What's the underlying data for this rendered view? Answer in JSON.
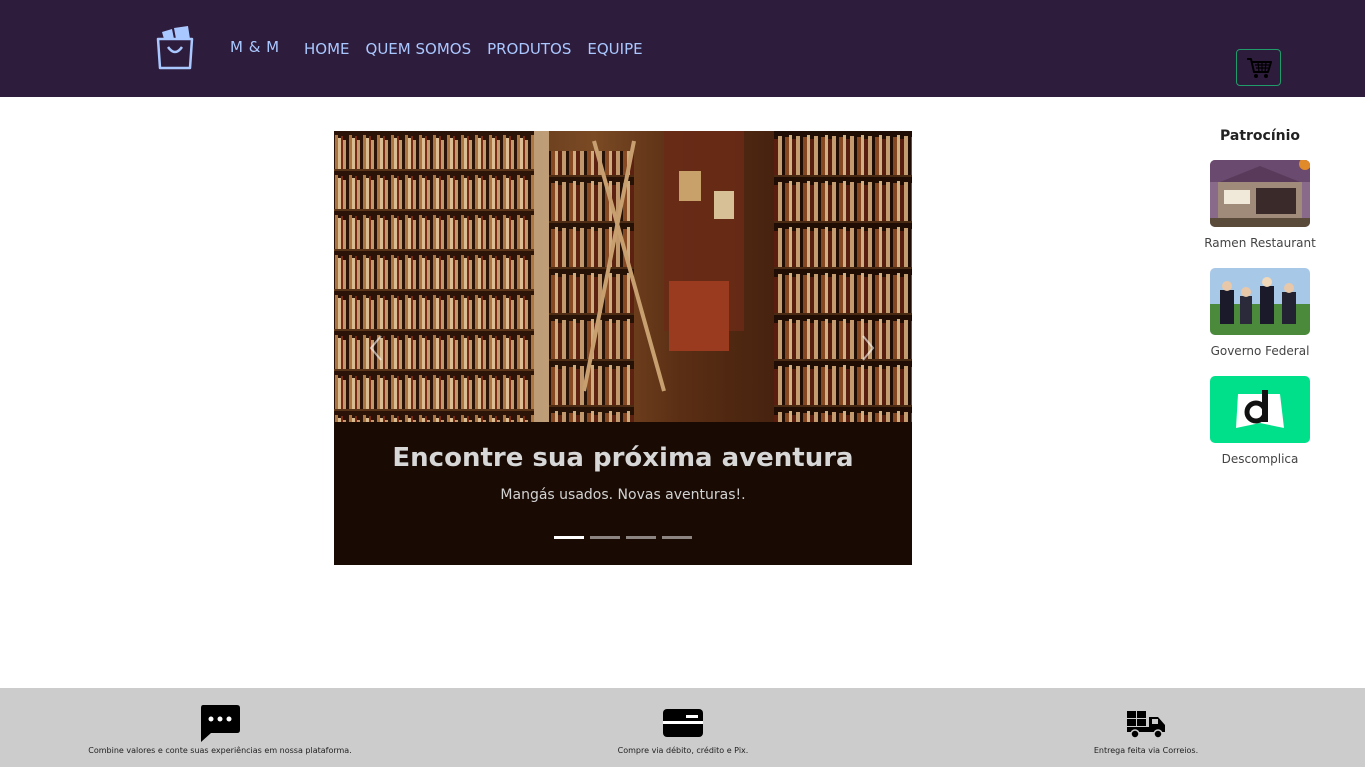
{
  "header": {
    "brand": "M & M",
    "nav": [
      "HOME",
      "QUEM SOMOS",
      "PRODUTOS",
      "EQUIPE"
    ],
    "logo_icon": "shopping-bag-icon",
    "cart_icon": "shopping-cart-icon"
  },
  "carousel": {
    "title": "Encontre sua próxima aventura",
    "subtitle": "Mangás usados. Novas aventuras!.",
    "slides_count": 4,
    "active_slide": 1
  },
  "sponsors": {
    "heading": "Patrocínio",
    "items": [
      {
        "name": "Ramen Restaurant"
      },
      {
        "name": "Governo Federal"
      },
      {
        "name": "Descomplica"
      }
    ]
  },
  "footer": {
    "features": [
      {
        "icon": "chat-bubble-icon",
        "text": "Combine valores e conte suas experiências em nossa plataforma."
      },
      {
        "icon": "credit-card-icon",
        "text": "Compre via débito, crédito e Pix."
      },
      {
        "icon": "delivery-truck-icon",
        "text": "Entrega feita via Correios."
      }
    ]
  },
  "colors": {
    "header_bg": "#2e1c3c",
    "nav_text": "#a9c8ff",
    "cart_border": "#1f9c6a",
    "footer_bg": "#cccccc",
    "descomplica_green": "#00e08a"
  }
}
